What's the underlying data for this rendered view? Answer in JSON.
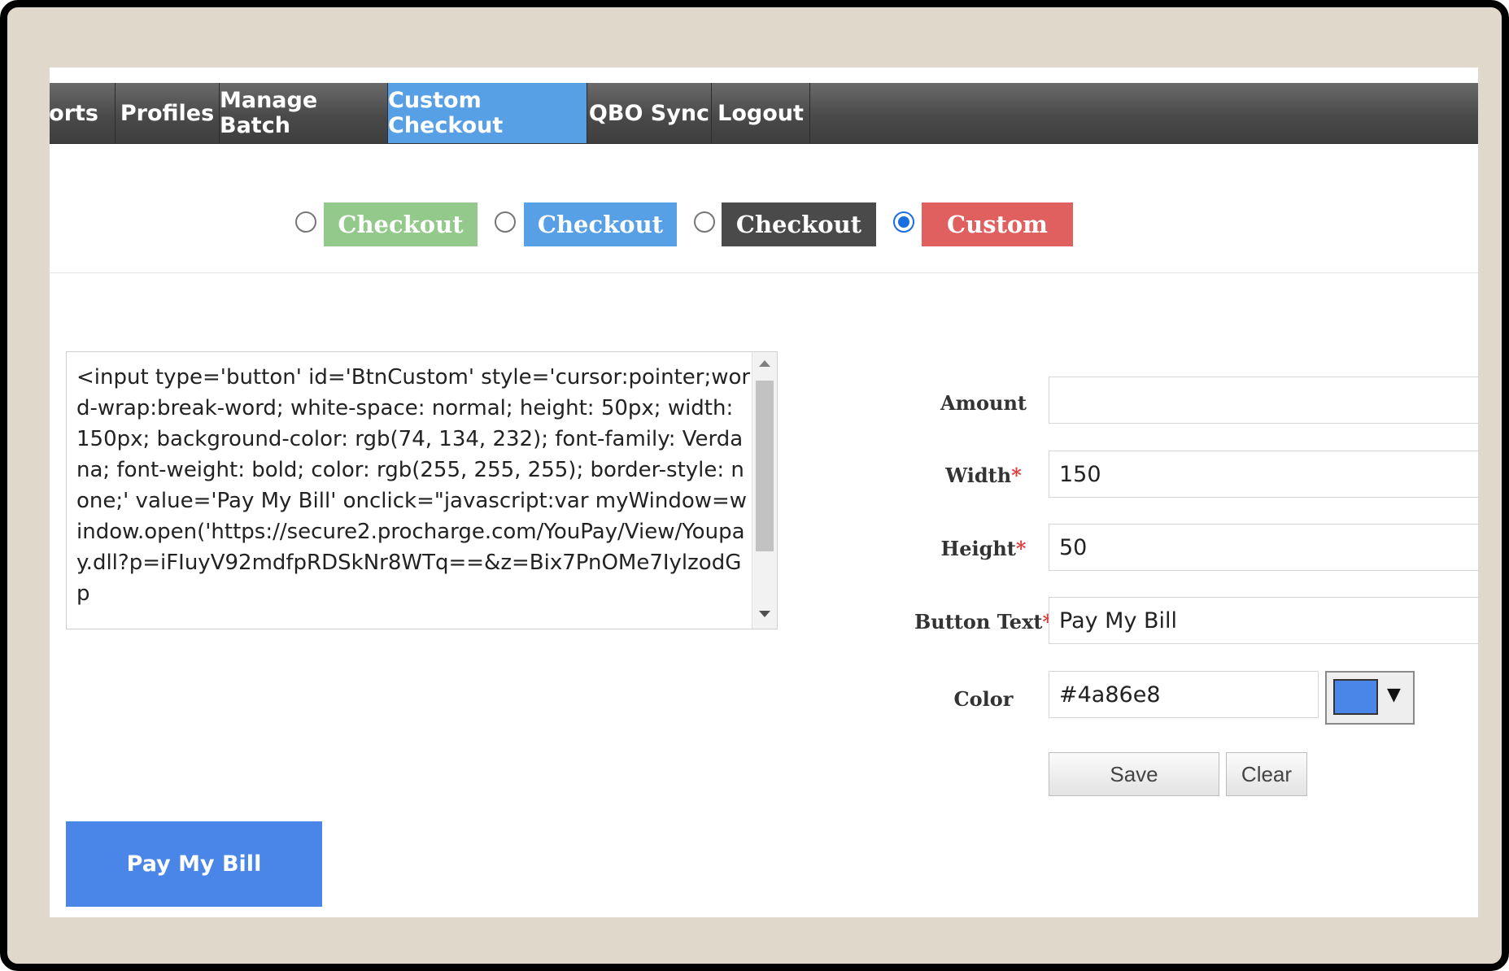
{
  "nav": {
    "items": [
      {
        "label": "orts"
      },
      {
        "label": "Profiles"
      },
      {
        "label": "Manage Batch"
      },
      {
        "label": "Custom Checkout"
      },
      {
        "label": "QBO Sync"
      },
      {
        "label": "Logout"
      }
    ],
    "active_index": 3
  },
  "presets": [
    {
      "label": "Checkout",
      "color": "#93c98a",
      "selected": false
    },
    {
      "label": "Checkout",
      "color": "#57a0e6",
      "selected": false
    },
    {
      "label": "Checkout",
      "color": "#4a4a4a",
      "selected": false
    },
    {
      "label": "Custom",
      "color": "#e06060",
      "selected": true
    }
  ],
  "code": {
    "text": "<input type='button' id='BtnCustom' style='cursor:pointer;word-wrap:break-word; white-space: normal; height: 50px; width: 150px; background-color: rgb(74, 134, 232); font-family: Verdana; font-weight: bold; color: rgb(255, 255, 255); border-style: none;' value='Pay My Bill' onclick=\"javascript:var myWindow=window.open('https://secure2.procharge.com/YouPay/View/Youpay.dll?p=iFIuyV92mdfpRDSkNr8WTq==&z=Bix7PnOMe7IylzodGp"
  },
  "form": {
    "amount": {
      "label": "Amount",
      "value": ""
    },
    "width": {
      "label": "Width",
      "required": "*",
      "value": "150"
    },
    "height": {
      "label": "Height",
      "required": "*",
      "value": "50"
    },
    "button_text": {
      "label": "Button Text",
      "required": "*",
      "value": "Pay My Bill"
    },
    "color": {
      "label": "Color",
      "value": "#4a86e8",
      "swatch": "#4a86e8",
      "picker_arrow": "▼"
    },
    "save_label": "Save",
    "clear_label": "Clear"
  },
  "preview": {
    "label": "Pay My Bill",
    "color": "#4a86e8"
  }
}
